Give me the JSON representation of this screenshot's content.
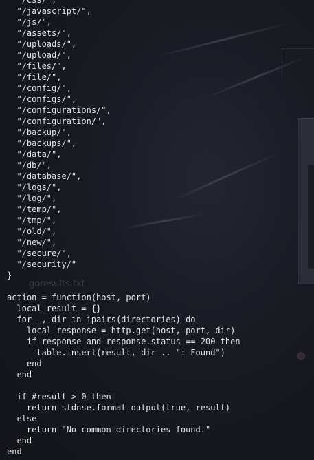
{
  "desktop": {
    "ghost_labels": [
      "goresults.txt"
    ]
  },
  "code": {
    "lines": [
      "  \"/css/\",",
      "  \"/javascript/\",",
      "  \"/js/\",",
      "  \"/assets/\",",
      "  \"/uploads/\",",
      "  \"/upload/\",",
      "  \"/files/\",",
      "  \"/file/\",",
      "  \"/config/\",",
      "  \"/configs/\",",
      "  \"/configurations/\",",
      "  \"/configuration/\",",
      "  \"/backup/\",",
      "  \"/backups/\",",
      "  \"/data/\",",
      "  \"/db/\",",
      "  \"/database/\",",
      "  \"/logs/\",",
      "  \"/log/\",",
      "  \"/temp/\",",
      "  \"/tmp/\",",
      "  \"/old/\",",
      "  \"/new/\",",
      "  \"/secure/\",",
      "  \"/security/\"",
      "}",
      "",
      "action = function(host, port)",
      "  local result = {}",
      "  for _, dir in ipairs(directories) do",
      "    local response = http.get(host, port, dir)",
      "    if response and response.status == 200 then",
      "      table.insert(result, dir .. \": Found\")",
      "    end",
      "  end",
      "",
      "  if #result > 0 then",
      "    return stdnse.format_output(true, result)",
      "  else",
      "    return \"No common directories found.\"",
      "  end",
      "end"
    ]
  },
  "colors": {
    "background": "#14161d",
    "text": "#e6e6e6"
  }
}
